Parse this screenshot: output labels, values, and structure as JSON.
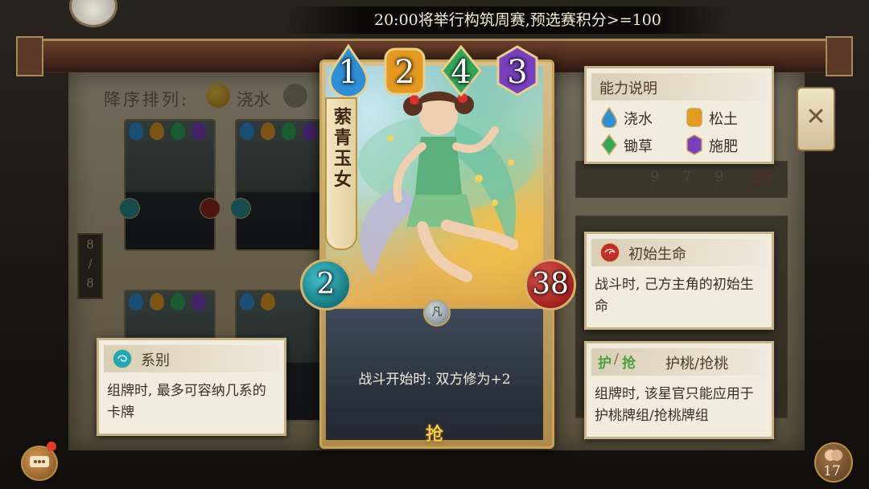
{
  "announcement": "20:00将举行构筑周赛,预选赛积分>=100",
  "sort": {
    "label": "降序排列:",
    "option": "浇水"
  },
  "page_indicator": {
    "current": "8",
    "total": "8"
  },
  "background_numbers": [
    "9",
    "7",
    "9",
    "25"
  ],
  "card": {
    "name": "萦青玉女",
    "costs": [
      {
        "value": "1",
        "type": "water",
        "color": "#2e8fd6"
      },
      {
        "value": "2",
        "type": "soil",
        "color": "#e39a1f"
      },
      {
        "value": "4",
        "type": "weed",
        "color": "#2fa85a"
      },
      {
        "value": "3",
        "type": "fertilize",
        "color": "#7a3fbf"
      }
    ],
    "attack": "2",
    "health": "38",
    "faction_glyph": "凡",
    "ability": "战斗开始时: 双方修为+2",
    "tag": "抢"
  },
  "legend_panel": {
    "title": "能力说明",
    "items": [
      {
        "label": "浇水",
        "color": "#2e8fd6"
      },
      {
        "label": "松土",
        "color": "#e39a1f"
      },
      {
        "label": "锄草",
        "color": "#2fa85a"
      },
      {
        "label": "施肥",
        "color": "#7a3fbf"
      }
    ]
  },
  "health_panel": {
    "title": "初始生命",
    "body": "战斗时, 己方主角的初始生命"
  },
  "series_panel": {
    "title": "系别",
    "body": "组牌时, 最多可容纳几系的卡牌"
  },
  "protect_panel": {
    "badge_1": "护",
    "badge_2": "抢",
    "title": "护桃/抢桃",
    "body": "组牌时, 该星官只能应用于护桃牌组/抢桃牌组"
  },
  "coin_count": "17",
  "colors": {
    "gold_border": "#c9a35a",
    "attack": "#157780",
    "health": "#a21f1f",
    "notify": "#e53a2a"
  }
}
